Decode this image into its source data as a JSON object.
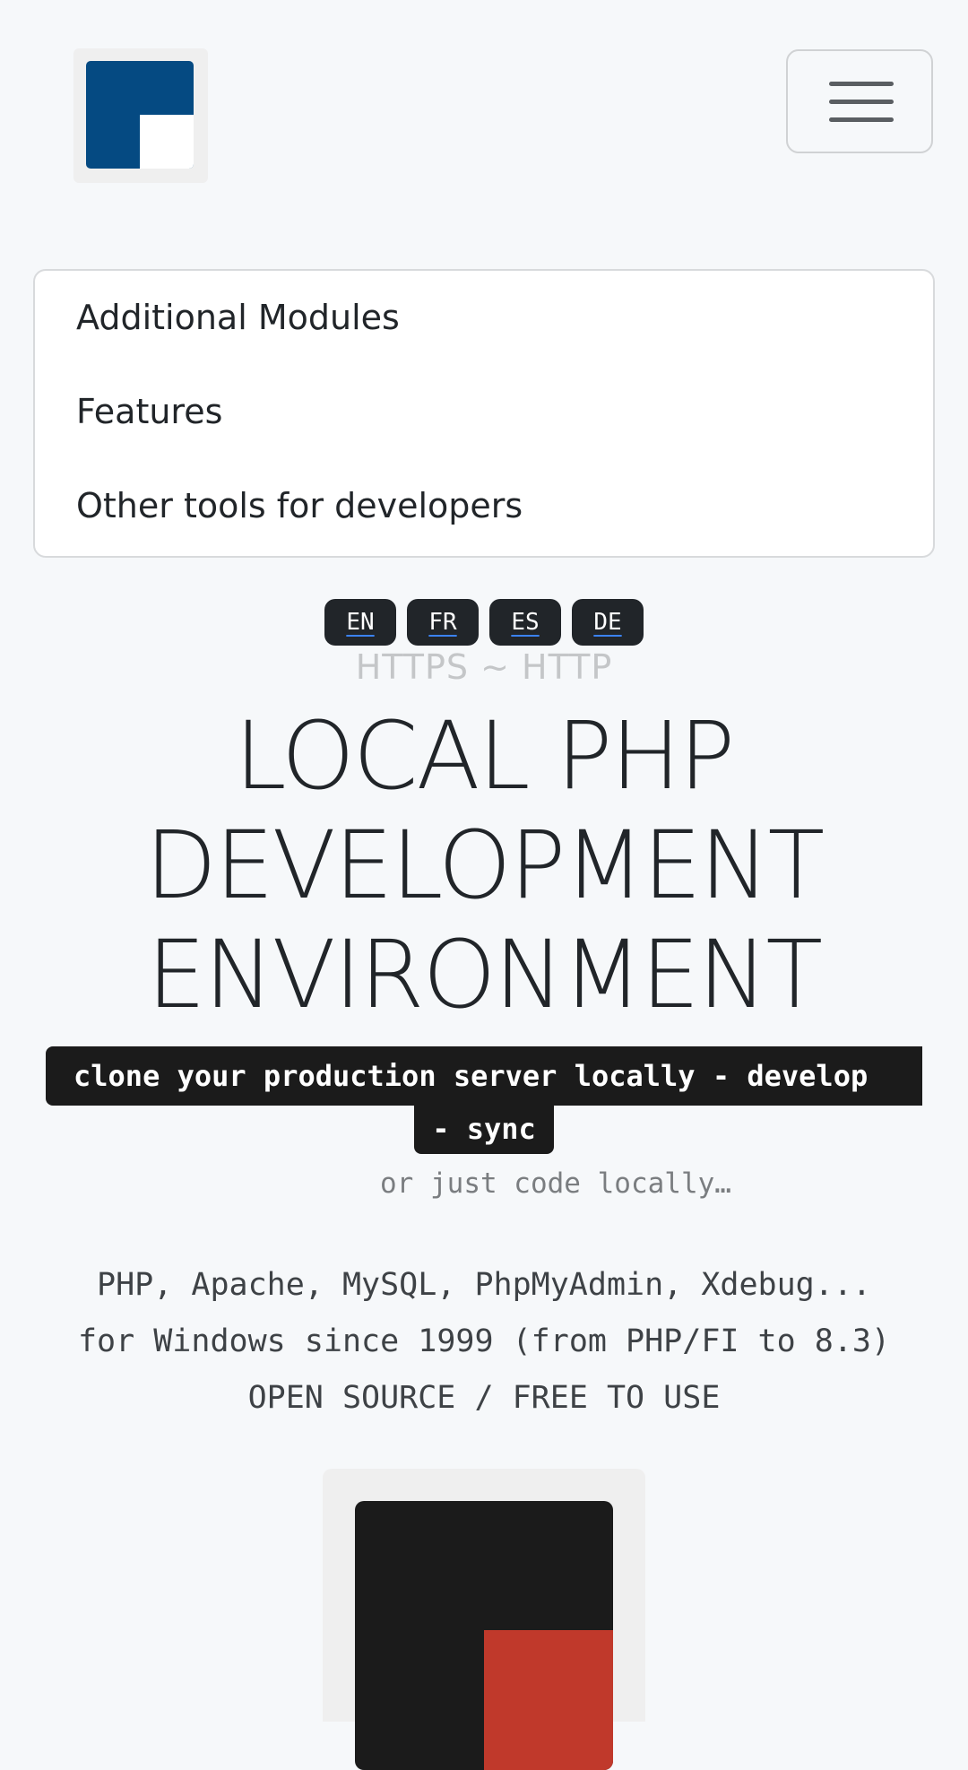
{
  "header": {
    "logo_icon": "laragon-logo-icon",
    "menu_icon": "hamburger-menu-icon",
    "colors": {
      "logo_blue": "#054a82",
      "logo_white": "#ffffff"
    }
  },
  "nav": {
    "items": [
      {
        "label": "Additional Modules"
      },
      {
        "label": "Features"
      },
      {
        "label": "Other tools for developers"
      }
    ]
  },
  "languages": [
    {
      "label": "EN"
    },
    {
      "label": "FR"
    },
    {
      "label": "ES"
    },
    {
      "label": "DE"
    }
  ],
  "hero": {
    "protocols": "HTTPS ~ HTTP",
    "title_lines": [
      "LOCAL PHP",
      "DEVELOPMENT",
      "ENVIRONMENT"
    ],
    "tagline_line1": "clone your production server locally - develop",
    "tagline_line2": "- sync",
    "subtagline": "or just code locally…",
    "info_lines": [
      "PHP, Apache, MySQL, PhpMyAdmin, Xdebug...",
      "for Windows since 1999 (from PHP/FI to 8.3)",
      "OPEN SOURCE / FREE TO USE"
    ]
  },
  "preview": {
    "icon": "app-preview-logo",
    "colors": {
      "dark": "#1b1b1b",
      "accent": "#c0392b"
    }
  }
}
